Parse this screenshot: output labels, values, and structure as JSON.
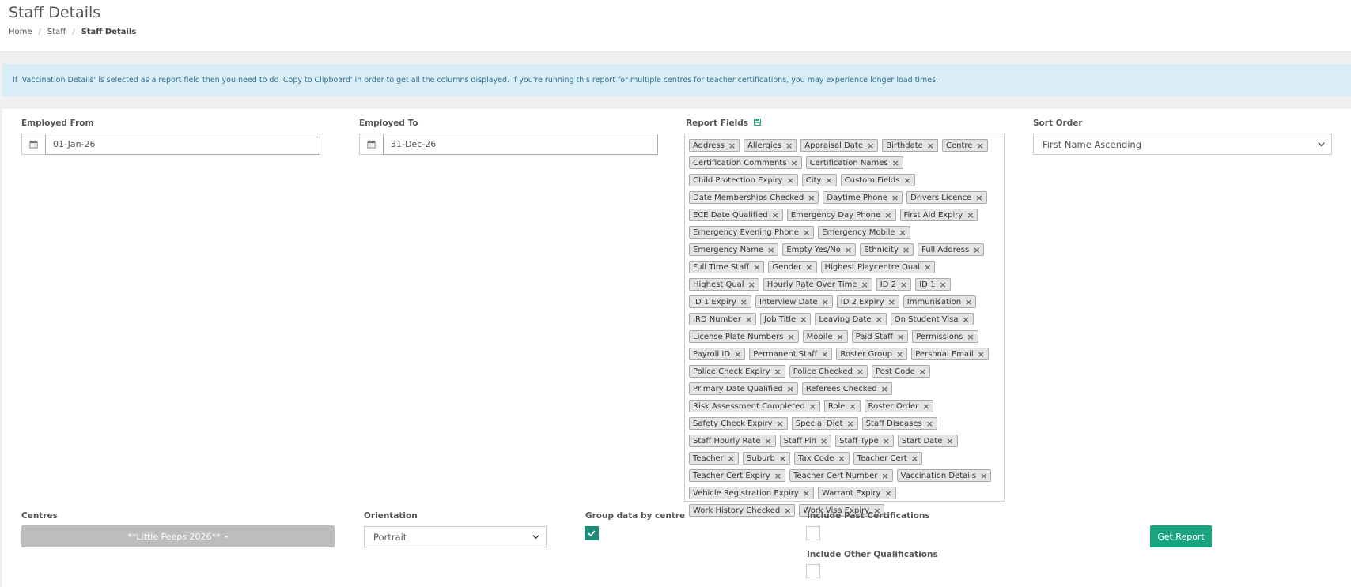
{
  "header": {
    "title": "Staff Details",
    "breadcrumb": {
      "home": "Home",
      "staff": "Staff",
      "current": "Staff Details",
      "separator": "/"
    }
  },
  "alert": {
    "text": "If 'Vaccination Details' is selected as a report field then you need to do 'Copy to Clipboard' in order to get all the columns displayed. If you're running this report for multiple centres for teacher certifications, you may experience longer load times."
  },
  "form": {
    "employed_from": {
      "label": "Employed From",
      "value": "01-Jan-26"
    },
    "employed_to": {
      "label": "Employed To",
      "value": "31-Dec-26"
    },
    "report_fields": {
      "label": "Report Fields",
      "tags": [
        "Address",
        "Allergies",
        "Appraisal Date",
        "Birthdate",
        "Centre",
        "Certification Comments",
        "Certification Names",
        "Child Protection Expiry",
        "City",
        "Custom Fields",
        "Date Memberships Checked",
        "Daytime Phone",
        "Drivers Licence",
        "ECE Date Qualified",
        "Emergency Day Phone",
        "First Aid Expiry",
        "Emergency Evening Phone",
        "Emergency Mobile",
        "Emergency Name",
        "Empty Yes/No",
        "Ethnicity",
        "Full Address",
        "Full Time Staff",
        "Gender",
        "Highest Playcentre Qual",
        "Highest Qual",
        "Hourly Rate Over Time",
        "ID 2",
        "ID 1",
        "ID 1 Expiry",
        "Interview Date",
        "ID 2 Expiry",
        "Immunisation",
        "IRD Number",
        "Job Title",
        "Leaving Date",
        "On Student Visa",
        "License Plate Numbers",
        "Mobile",
        "Paid Staff",
        "Permissions",
        "Payroll ID",
        "Permanent Staff",
        "Roster Group",
        "Personal Email",
        "Police Check Expiry",
        "Police Checked",
        "Post Code",
        "Primary Date Qualified",
        "Referees Checked",
        "Risk Assessment Completed",
        "Role",
        "Roster Order",
        "Safety Check Expiry",
        "Special Diet",
        "Staff Diseases",
        "Staff Hourly Rate",
        "Staff Pin",
        "Staff Type",
        "Start Date",
        "Teacher",
        "Suburb",
        "Tax Code",
        "Teacher Cert",
        "Teacher Cert Expiry",
        "Teacher Cert Number",
        "Vaccination Details",
        "Vehicle Registration Expiry",
        "Warrant Expiry",
        "Work History Checked",
        "Work Visa Expiry"
      ]
    },
    "sort_order": {
      "label": "Sort Order",
      "value": "First Name Ascending"
    },
    "centres": {
      "label": "Centres",
      "value": "**Little Peeps 2026**"
    },
    "orientation": {
      "label": "Orientation",
      "value": "Portrait"
    },
    "group_by_centre": {
      "label": "Group data by centre",
      "checked": true
    },
    "include_past_certs": {
      "label": "Include Past Certifications",
      "checked": false
    },
    "include_other_quals": {
      "label": "Include Other Qualifications",
      "checked": false
    },
    "get_report_label": "Get Report"
  },
  "icons": {
    "calendar": "calendar-icon",
    "save": "save-icon",
    "chevron": "chevron-down-icon",
    "check": "check-icon",
    "remove": "close-icon"
  },
  "colors": {
    "alert_bg": "#d9edf7",
    "primary": "#1aa37f",
    "checkbox_checked": "#1b8a78",
    "centre_button": "#bdbdbd"
  }
}
